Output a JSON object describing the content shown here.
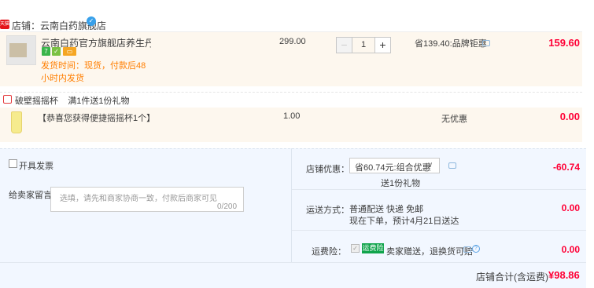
{
  "store": {
    "label": "店铺：",
    "name": "云南白药旗舰店",
    "badge": "天猫"
  },
  "product": {
    "title": "云南白药官方旗舰店养生丹参粉…",
    "ship_time_label": "发货时间：",
    "ship_time": "现货，付款后48小时内发货",
    "unit_price": "299.00",
    "quantity": "1",
    "decrement": "−",
    "increment": "+",
    "discount_note": "省139.40:品牌钜惠",
    "total": "159.60"
  },
  "gift": {
    "section_title": "破壁摇摇杯",
    "rule": "满1件送1份礼物",
    "desc": "【恭喜您获得便捷摇摇杯1个】",
    "qty": "1.00",
    "shipping": "无优惠",
    "price": "0.00"
  },
  "invoice": {
    "label": "开具发票"
  },
  "message": {
    "label": "给卖家留言：",
    "placeholder": "选填，请先和商家协商一致，付款后商家可见",
    "count": "0/200"
  },
  "store_discount": {
    "label": "店铺优惠：",
    "selected": "省60.74元:组合优惠",
    "gift_note": "送1份礼物",
    "amount": "-60.74"
  },
  "delivery": {
    "label": "运送方式：",
    "method": "普通配送 快递 免邮",
    "eta": "现在下单，预计4月21日送达",
    "amount": "0.00"
  },
  "insurance": {
    "label": "运费险：",
    "badge": "运费险",
    "desc": "卖家赠送，退换货可赔",
    "amount": "0.00"
  },
  "summary": {
    "label": "店铺合计(含运费)",
    "total": "¥98.86"
  },
  "colors": {
    "price_red": "#ff0036",
    "orange": "#ff7e00",
    "insurance_green": "#11a44c",
    "bg_blue": "#f2f7ff",
    "row_beige": "#fdf7ee"
  }
}
